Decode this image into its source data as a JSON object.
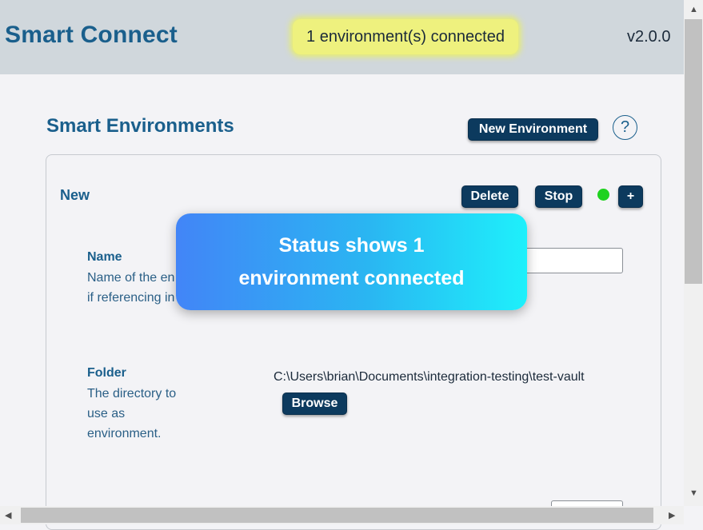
{
  "header": {
    "app_title": "Smart Connect",
    "status": "1 environment(s) connected",
    "version": "v2.0.0"
  },
  "section": {
    "title": "Smart Environments",
    "new_environment_label": "New Environment",
    "help_label": "?"
  },
  "environment": {
    "name": "New",
    "delete_label": "Delete",
    "stop_label": "Stop",
    "add_label": "+",
    "status_color": "#1fd21f",
    "fields": {
      "name_label": "Name",
      "name_desc_line1": "Name of the en",
      "name_desc_line2": "if referencing in",
      "name_value": "",
      "folder_label": "Folder",
      "folder_desc_line1": "The directory to",
      "folder_desc_line2": "use as",
      "folder_desc_line3": "environment.",
      "folder_path": "C:\\Users\\brian\\Documents\\integration-testing\\test-vault",
      "browse_label": "Browse"
    }
  },
  "toast": {
    "line1": "Status shows 1",
    "line2": "environment connected"
  },
  "scrollbars": {
    "up_arrow": "▲",
    "down_arrow": "▼",
    "left_arrow": "◀",
    "right_arrow": "▶"
  }
}
